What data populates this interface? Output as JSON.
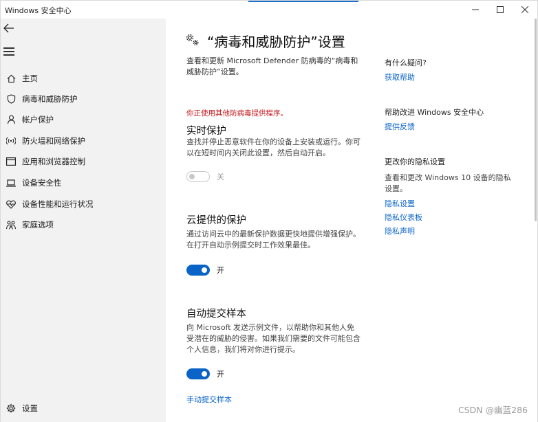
{
  "window": {
    "title": "Windows 安全中心",
    "min_symbol": "—",
    "max_symbol": "☐",
    "close_symbol": "✕"
  },
  "sidebar": {
    "items": [
      {
        "label": "主页",
        "icon": "home-icon"
      },
      {
        "label": "病毒和威胁防护",
        "icon": "shield-icon"
      },
      {
        "label": "帐户保护",
        "icon": "person-icon"
      },
      {
        "label": "防火墙和网络保护",
        "icon": "wireless-icon"
      },
      {
        "label": "应用和浏览器控制",
        "icon": "browser-window-icon"
      },
      {
        "label": "设备安全性",
        "icon": "laptop-icon"
      },
      {
        "label": "设备性能和运行状况",
        "icon": "heart-pulse-icon"
      },
      {
        "label": "家庭选项",
        "icon": "family-icon"
      }
    ],
    "settings_label": "设置"
  },
  "main": {
    "title": "“病毒和威胁防护”设置",
    "intro": "查看和更新 Microsoft Defender 防病毒的“病毒和威胁防护”设置。",
    "warning": "你正使用其他防病毒提供程序。",
    "realtime": {
      "title": "实时保护",
      "desc": "查找并停止恶意软件在你的设备上安装或运行。你可以在短时间内关闭此设置，然后自动开启。",
      "state": "关"
    },
    "cloud": {
      "title": "云提供的保护",
      "desc": "通过访问云中的最新保护数据更快地提供增强保护。在打开自动示例提交时工作效果最佳。",
      "state": "开"
    },
    "sample": {
      "title": "自动提交样本",
      "desc": "向 Microsoft 发送示例文件，以帮助你和其他人免受潜在的威胁的侵害。如果我们需要的文件可能包含个人信息，我们将对你进行提示。",
      "state": "开",
      "manual_link": "手动提交样本"
    }
  },
  "right": {
    "question_head": "有什么疑问?",
    "get_help": "获取帮助",
    "improve_head": "帮助改进 Windows 安全中心",
    "feedback": "提供反馈",
    "privacy_head": "更改你的隐私设置",
    "privacy_text": "查看和更改 Windows 10 设备的隐私设置。",
    "privacy_settings": "隐私设置",
    "privacy_dashboard": "隐私仪表板",
    "privacy_statement": "隐私声明"
  },
  "watermark": "CSDN @幽蓝286",
  "colors": {
    "accent": "#0a64c8",
    "warning": "#c4161c",
    "sidebar_bg": "#f2f2f2"
  }
}
